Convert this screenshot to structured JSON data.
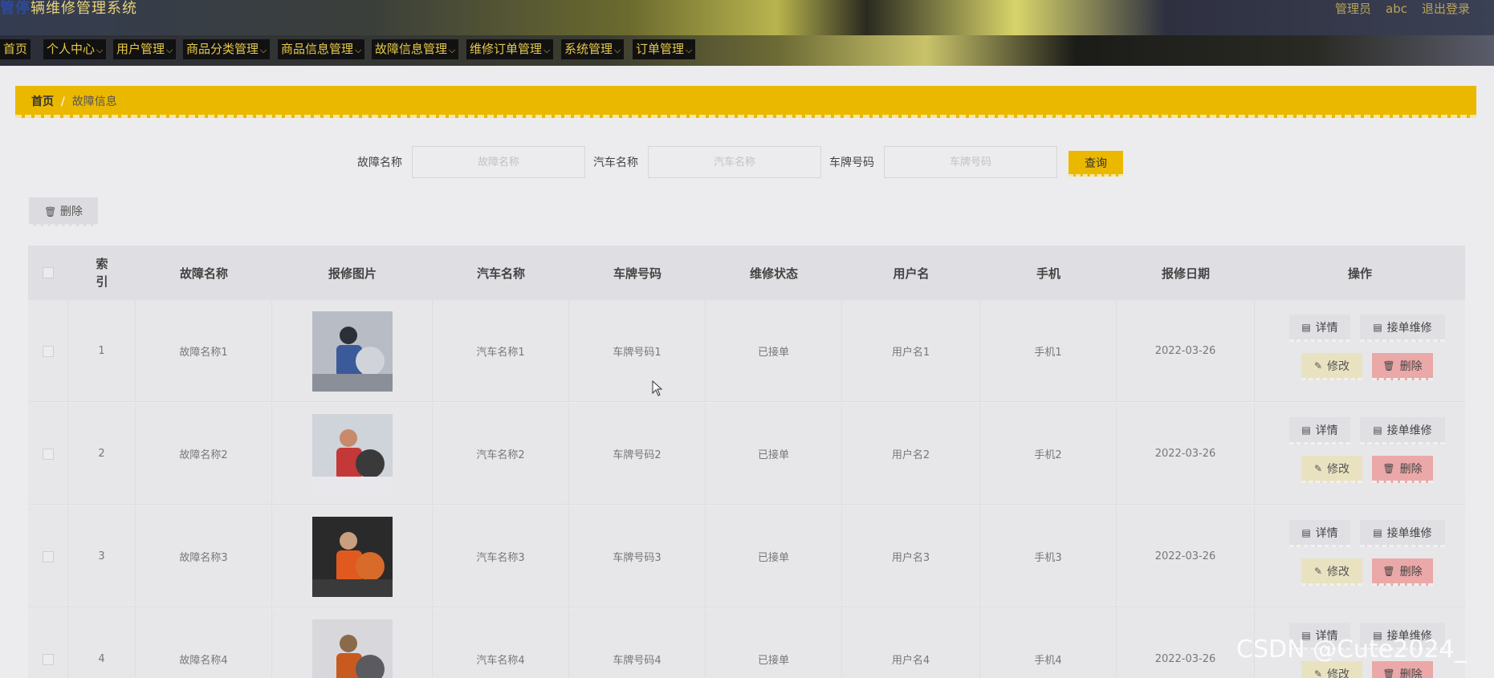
{
  "header": {
    "title_lead": "管停",
    "title": "辆维修管理系统",
    "role": "管理员",
    "username": "abc",
    "logout": "退出登录"
  },
  "nav": [
    {
      "label": "首页",
      "has_menu": false
    },
    {
      "label": "个人中心",
      "has_menu": true
    },
    {
      "label": "用户管理",
      "has_menu": true
    },
    {
      "label": "商品分类管理",
      "has_menu": true
    },
    {
      "label": "商品信息管理",
      "has_menu": true
    },
    {
      "label": "故障信息管理",
      "has_menu": true
    },
    {
      "label": "维修订单管理",
      "has_menu": true
    },
    {
      "label": "系统管理",
      "has_menu": true
    },
    {
      "label": "订单管理",
      "has_menu": true
    }
  ],
  "breadcrumb": {
    "home": "首页",
    "sep": "/",
    "current": "故障信息"
  },
  "search": {
    "fault_label": "故障名称",
    "fault_placeholder": "故障名称",
    "car_label": "汽车名称",
    "car_placeholder": "汽车名称",
    "plate_label": "车牌号码",
    "plate_placeholder": "车牌号码",
    "query": "查询"
  },
  "toolbar": {
    "delete": "删除"
  },
  "columns": [
    "索引",
    "故障名称",
    "报修图片",
    "汽车名称",
    "车牌号码",
    "维修状态",
    "用户名",
    "手机",
    "报修日期",
    "操作"
  ],
  "rows": [
    {
      "index": "1",
      "fault": "故障名称1",
      "car": "汽车名称1",
      "plate": "车牌号码1",
      "status": "已接单",
      "user": "用户名1",
      "phone": "手机1",
      "date": "2022-03-26"
    },
    {
      "index": "2",
      "fault": "故障名称2",
      "car": "汽车名称2",
      "plate": "车牌号码2",
      "status": "已接单",
      "user": "用户名2",
      "phone": "手机2",
      "date": "2022-03-26"
    },
    {
      "index": "3",
      "fault": "故障名称3",
      "car": "汽车名称3",
      "plate": "车牌号码3",
      "status": "已接单",
      "user": "用户名3",
      "phone": "手机3",
      "date": "2022-03-26"
    },
    {
      "index": "4",
      "fault": "故障名称4",
      "car": "汽车名称4",
      "plate": "车牌号码4",
      "status": "已接单",
      "user": "用户名4",
      "phone": "手机4",
      "date": "2022-03-26"
    }
  ],
  "actions": {
    "detail": "详情",
    "accept": "接单维修",
    "edit": "修改",
    "delete": "删除"
  },
  "watermark": "CSDN @Cute2024_",
  "colors": {
    "accent": "#ebb800",
    "nav_text": "#e6c84a",
    "delete_bg": "#eba8a8",
    "edit_bg": "#e8e2c0"
  }
}
